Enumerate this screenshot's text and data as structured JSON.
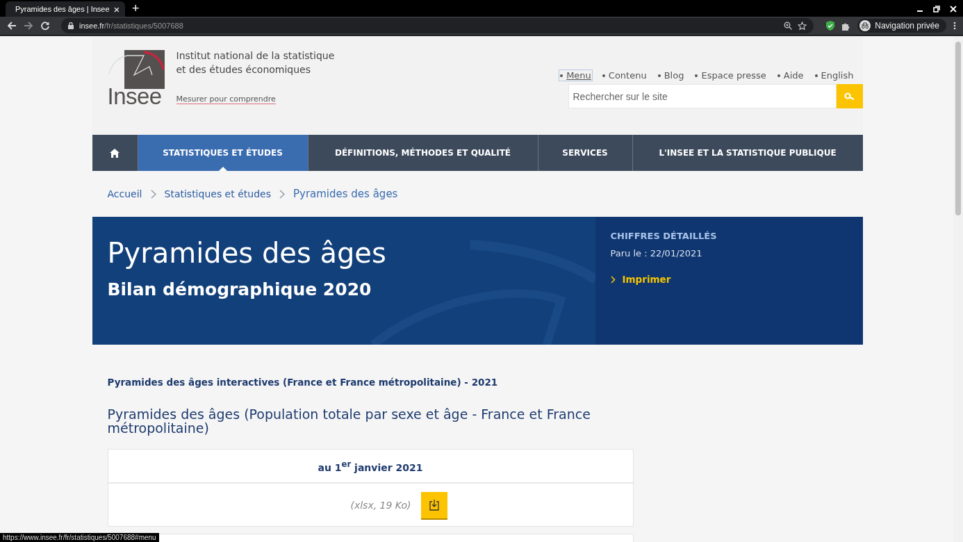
{
  "browser": {
    "tab_title": "Pyramides des âges | Insee",
    "tab_close": "×",
    "new_tab": "+",
    "url_host": "insee.fr",
    "url_path": "/fr/statistiques/5007688",
    "profile": "Navigation privée"
  },
  "header": {
    "org_name": "Institut national de la statistique et des études économiques",
    "logo_text": "Insee",
    "tagline": "Mesurer pour comprendre",
    "links": [
      {
        "label": "Menu",
        "focused": true
      },
      {
        "label": "Contenu",
        "focused": false
      },
      {
        "label": "Blog",
        "focused": false
      },
      {
        "label": "Espace presse",
        "focused": false
      },
      {
        "label": "Aide",
        "focused": false
      },
      {
        "label": "English",
        "focused": false
      }
    ],
    "search": {
      "placeholder": "Rechercher sur le site"
    }
  },
  "nav": [
    {
      "kind": "home",
      "selected": false
    },
    {
      "kind": "text",
      "label": "STATISTIQUES ET ÉTUDES",
      "selected": true
    },
    {
      "kind": "text",
      "label": "DÉFINITIONS, MÉTHODES ET QUALITÉ",
      "selected": false
    },
    {
      "kind": "text",
      "label": "SERVICES",
      "selected": false
    },
    {
      "kind": "text",
      "label": "L'INSEE ET LA STATISTIQUE PUBLIQUE",
      "selected": false
    }
  ],
  "breadcrumb": [
    {
      "label": "Accueil",
      "current": false
    },
    {
      "label": "Statistiques et études",
      "current": false
    },
    {
      "label": "Pyramides des âges",
      "current": true
    }
  ],
  "banner": {
    "title": "Pyramides des âges",
    "subtitle": "Bilan démographique 2020",
    "category": "CHIFFRES DÉTAILLÉS",
    "published": "Paru le : 22/01/2021",
    "print": "Imprimer"
  },
  "section": {
    "title": "Pyramides des âges interactives (France et France métropolitaine) - 2021",
    "heading": "Pyramides des âges (Population totale par sexe et âge - France et France métropolitaine)",
    "table": {
      "header": "au 1$^{er}$ janvier 2021",
      "file": "(xlsx, 19 Ko)"
    }
  },
  "status_bar": "https://www.insee.fr/fr/statistiques/5007688#menu"
}
